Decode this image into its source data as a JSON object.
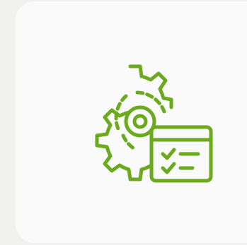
{
  "card": {
    "icon": "gear-with-checklist-icon",
    "accent_color": "#6aaa1c",
    "background_color": "#fafafa",
    "page_background": "#f1f1f0"
  }
}
